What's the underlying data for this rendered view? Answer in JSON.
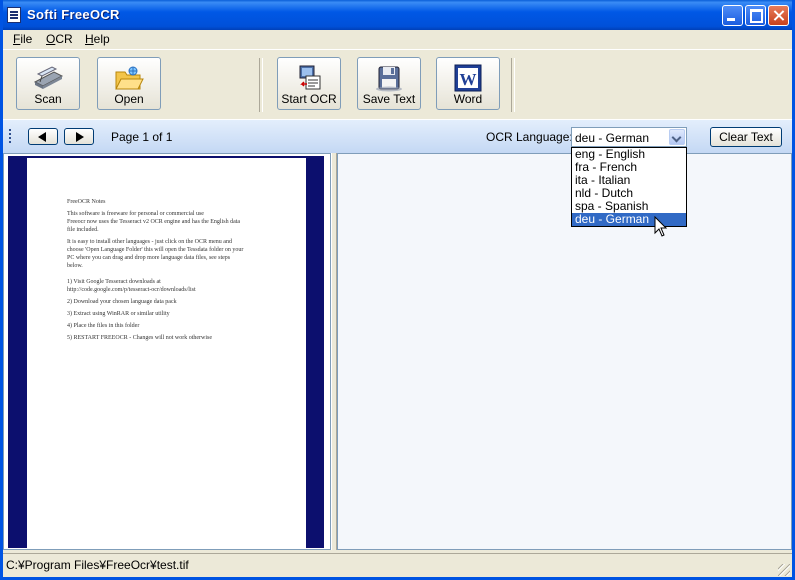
{
  "window": {
    "title": "Softi FreeOCR"
  },
  "menu": [
    {
      "id": "file",
      "label": "File",
      "accel": "F",
      "rest": "ile"
    },
    {
      "id": "ocr",
      "label": "OCR",
      "accel": "O",
      "rest": "CR"
    },
    {
      "id": "help",
      "label": "Help",
      "accel": "H",
      "rest": "elp"
    }
  ],
  "toolbar": {
    "scan": "Scan",
    "open": "Open",
    "start_ocr": "Start OCR",
    "save_text": "Save Text",
    "word": "Word"
  },
  "nav": {
    "page_label": "Page 1 of 1",
    "lang_label": "OCR Language:",
    "lang_selected": "deu - German",
    "clear_text": "Clear Text",
    "languages": [
      "eng - English",
      "fra - French",
      "ita - Italian",
      "nld - Dutch",
      "spa - Spanish",
      "deu - German"
    ],
    "highlighted_index": 5
  },
  "document": {
    "lines": [
      "FreeOCR Notes",
      "",
      "This software is freeware for personal or commercial use",
      "Freeocr now uses the Tesseract v2 OCR engine and has the English data",
      "file included.",
      "",
      "It is easy to install other languages - just click on the OCR menu and",
      "choose 'Open Language Folder' this will open the Tessdata folder on your",
      "PC where you can drag and drop more language data files, see steps",
      "below.",
      "",
      "",
      "1)  Visit Google Tesseract downloads at",
      "http://code.google.com/p/tesseract-ocr/downloads/list",
      "",
      "2)  Download your chosen language data pack",
      "",
      "3)  Extract using WinRAR or similar utility",
      "",
      "4)  Place the files in this folder",
      "",
      "5)  RESTART FREEOCR - Changes will not work otherwise"
    ]
  },
  "status": {
    "path": "C:¥Program Files¥FreeOcr¥test.tif"
  }
}
